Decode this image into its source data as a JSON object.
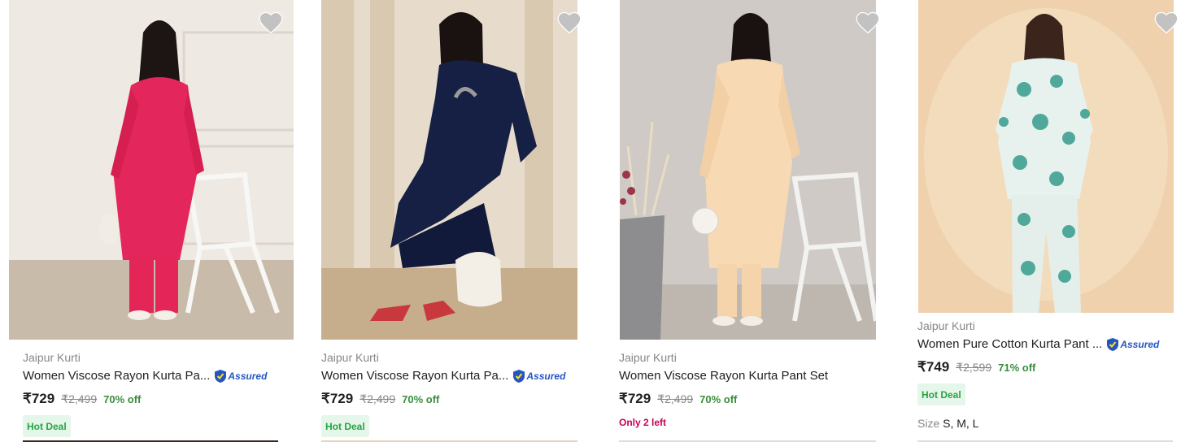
{
  "theme": {
    "brand_color": "#878787",
    "discount_color": "#388e3c",
    "assured_color": "#2455c3",
    "deal_bg": "#e5f7ea",
    "deal_text": "#26a541",
    "scarcity_color": "#c70055"
  },
  "wishlist_icon": "heart-icon",
  "assured_icon": "shield-check-icon",
  "products": [
    {
      "brand": "Jaipur Kurti",
      "title": "Women Viscose Rayon Kurta Pa...",
      "assured": "Assured",
      "price": "₹729",
      "mrp": "₹2,499",
      "discount": "70% off",
      "badge": "Hot Deal"
    },
    {
      "brand": "Jaipur Kurti",
      "title": "Women Viscose Rayon Kurta Pa...",
      "assured": "Assured",
      "price": "₹729",
      "mrp": "₹2,499",
      "discount": "70% off",
      "badge": "Hot Deal"
    },
    {
      "brand": "Jaipur Kurti",
      "title": "Women Viscose Rayon Kurta Pant Set",
      "price": "₹729",
      "mrp": "₹2,499",
      "discount": "70% off",
      "scarcity": "Only 2 left"
    },
    {
      "brand": "Jaipur Kurti",
      "title": "Women Pure Cotton Kurta Pant ...",
      "assured": "Assured",
      "price": "₹749",
      "mrp": "₹2,599",
      "discount": "71% off",
      "badge": "Hot Deal",
      "size_label": "Size",
      "sizes": "S, M, L"
    }
  ]
}
